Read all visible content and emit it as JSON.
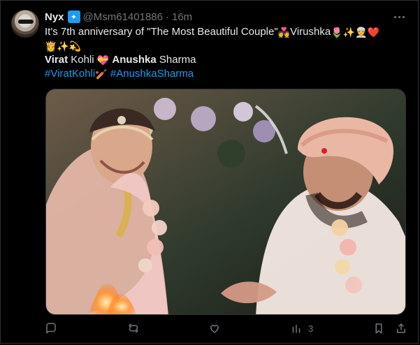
{
  "tweet": {
    "author_name": "Nyx",
    "verified_badge_glyph": "✦",
    "handle": "@Msm61401886",
    "separator": "·",
    "time": "16m",
    "line1_pre": "It's 7th anniversary of \"The Most Beautiful Couple\"",
    "line1_emoji1": "💑",
    "line1_mid": "Virushka",
    "line1_emoji_group": "🌷✨👳❤️",
    "line2_emojis": "👸✨💫",
    "line3_virat": "Virat",
    "line3_kohli": " Kohli",
    "line3_heart": "💝",
    "line3_anushka": "Anushka",
    "line3_sharma": " Sharma",
    "hashtag1": "#ViratKohli",
    "hashtag1_emoji": "🏏",
    "hashtag2": "#AnushkaSharma",
    "views_count": "3"
  },
  "icons": {
    "more": "more-icon",
    "reply": "reply-icon",
    "retweet": "retweet-icon",
    "like": "like-icon",
    "views": "views-icon",
    "bookmark": "bookmark-icon",
    "share": "share-icon"
  },
  "colors": {
    "background": "#000000",
    "text": "#e7e9ea",
    "muted": "#71767b",
    "link": "#1d9bf0"
  }
}
